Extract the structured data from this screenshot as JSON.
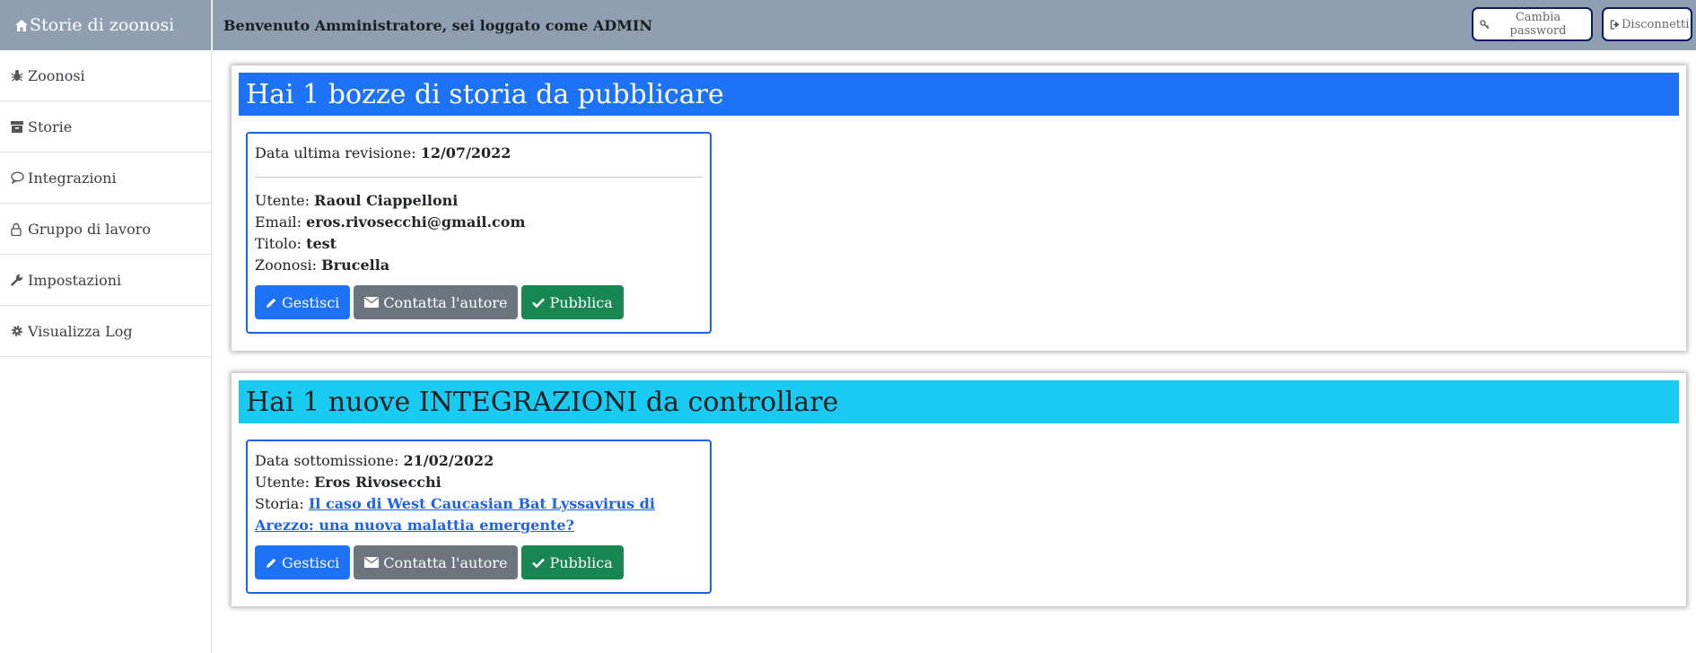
{
  "app": {
    "brand": "Storie di zoonosi",
    "welcome": "Benvenuto Amministratore, sei loggato come ADMIN"
  },
  "topbar": {
    "change_password": "Cambia password",
    "logout": "Disconnetti"
  },
  "sidebar": {
    "items": [
      {
        "label": "Zoonosi",
        "icon": "bug-icon"
      },
      {
        "label": "Storie",
        "icon": "archive-icon"
      },
      {
        "label": "Integrazioni",
        "icon": "comment-icon"
      },
      {
        "label": "Gruppo di lavoro",
        "icon": "lock-icon"
      },
      {
        "label": "Impostazioni",
        "icon": "wrench-icon"
      },
      {
        "label": "Visualizza Log",
        "icon": "gear-icon"
      }
    ]
  },
  "drafts": {
    "header": "Hai 1 bozze di storia da pubblicare",
    "items": [
      {
        "revision_label": "Data ultima revisione:",
        "revision_date": "12/07/2022",
        "user_label": "Utente:",
        "user": "Raoul Ciappelloni",
        "email_label": "Email:",
        "email": "eros.rivosecchi@gmail.com",
        "title_label": "Titolo:",
        "title": "test",
        "zoonosis_label": "Zoonosi:",
        "zoonosis": "Brucella"
      }
    ]
  },
  "integrations": {
    "header": "Hai 1 nuove INTEGRAZIONI da controllare",
    "items": [
      {
        "submitted_label": "Data sottomissione:",
        "submitted_date": "21/02/2022",
        "user_label": "Utente:",
        "user": "Eros Rivosecchi",
        "story_label": "Storia:",
        "story": "Il caso di West Caucasian Bat Lyssavirus di Arezzo: una nuova malattia emergente?"
      }
    ]
  },
  "buttons": {
    "manage": "Gestisci",
    "contact": "Contatta l'autore",
    "publish": "Pubblica"
  },
  "colors": {
    "topbar": "#8f9eb0",
    "primary": "#1d72f5",
    "info": "#19cbf0",
    "secondary": "#6c757d",
    "success": "#198754",
    "box_border": "#1d63e6"
  }
}
